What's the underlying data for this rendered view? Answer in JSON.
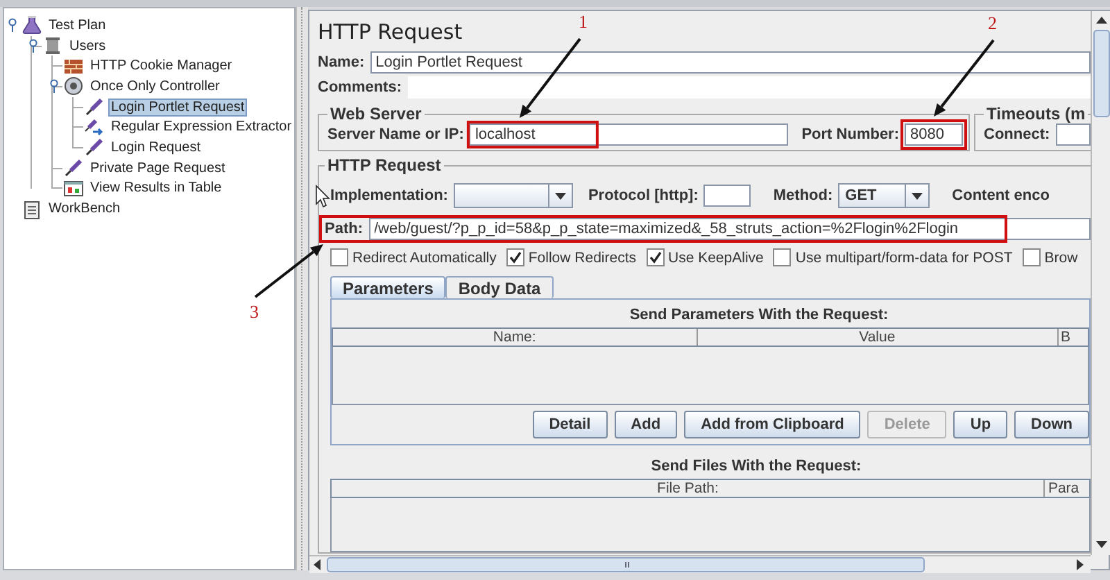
{
  "tree": [
    {
      "label": "Test Plan",
      "kind": "test-plan",
      "selected": false,
      "expanded": true,
      "children": [
        {
          "label": "Users",
          "kind": "thread-group",
          "selected": false,
          "expanded": true,
          "children": [
            {
              "label": "HTTP Cookie Manager",
              "kind": "config",
              "selected": false
            },
            {
              "label": "Once Only Controller",
              "kind": "controller",
              "selected": false,
              "expanded": true,
              "children": [
                {
                  "label": "Login Portlet Request",
                  "kind": "sampler",
                  "selected": true
                },
                {
                  "label": "Regular Expression Extractor",
                  "kind": "post-processor",
                  "selected": false
                },
                {
                  "label": "Login Request",
                  "kind": "sampler",
                  "selected": false
                }
              ]
            },
            {
              "label": "Private Page Request",
              "kind": "sampler",
              "selected": false
            },
            {
              "label": "View Results in Table",
              "kind": "listener",
              "selected": false
            }
          ]
        }
      ]
    },
    {
      "label": "WorkBench",
      "kind": "workbench",
      "selected": false
    }
  ],
  "editor": {
    "title": "HTTP Request",
    "name": {
      "label": "Name:",
      "value": "Login Portlet Request"
    },
    "comments": {
      "label": "Comments:"
    },
    "web_server": {
      "legend": "Web Server",
      "server": {
        "label": "Server Name or IP:",
        "value": "localhost"
      },
      "port": {
        "label": "Port Number:",
        "value": "8080"
      }
    },
    "timeouts": {
      "legend": "Timeouts (m",
      "connect": {
        "label": "Connect:"
      }
    },
    "http_request": {
      "legend": "HTTP Request",
      "implementation": {
        "label": "Implementation:"
      },
      "protocol": {
        "label": "Protocol [http]:"
      },
      "method": {
        "label": "Method:",
        "value": "GET"
      },
      "content_encoding": {
        "label": "Content enco"
      },
      "path": {
        "label": "Path:",
        "value": "/web/guest/?p_p_id=58&p_p_state=maximized&_58_struts_action=%2Flogin%2Flogin"
      },
      "options": [
        {
          "label": "Redirect Automatically",
          "checked": false
        },
        {
          "label": "Follow Redirects",
          "checked": true
        },
        {
          "label": "Use KeepAlive",
          "checked": true
        },
        {
          "label": "Use multipart/form-data for POST",
          "checked": false
        },
        {
          "label": "Brow",
          "checked": false
        }
      ]
    },
    "tabs": [
      {
        "label": "Parameters",
        "selected": true
      },
      {
        "label": "Body Data",
        "selected": false
      }
    ],
    "parameters": {
      "heading": "Send Parameters With the Request:",
      "columns": [
        "Name:",
        "Value",
        "B"
      ],
      "buttons": [
        {
          "label": "Detail",
          "disabled": false
        },
        {
          "label": "Add",
          "disabled": false
        },
        {
          "label": "Add from Clipboard",
          "disabled": false
        },
        {
          "label": "Delete",
          "disabled": true
        },
        {
          "label": "Up",
          "disabled": false
        },
        {
          "label": "Down",
          "disabled": false
        }
      ]
    },
    "files": {
      "heading": "Send Files With the Request:",
      "columns": [
        "File Path:",
        "Para"
      ]
    }
  },
  "annotations": [
    {
      "number": "1"
    },
    {
      "number": "2"
    },
    {
      "number": "3"
    }
  ]
}
